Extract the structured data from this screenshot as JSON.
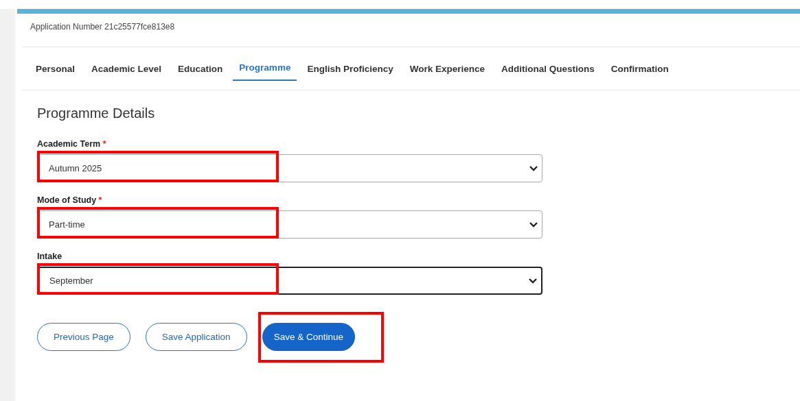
{
  "application_number": "Application Number 21c25577fce813e8",
  "tabs": [
    {
      "label": "Personal",
      "selected": false
    },
    {
      "label": "Academic Level",
      "selected": false
    },
    {
      "label": "Education",
      "selected": false
    },
    {
      "label": "Programme",
      "selected": true
    },
    {
      "label": "English Proficiency",
      "selected": false
    },
    {
      "label": "Work Experience",
      "selected": false
    },
    {
      "label": "Additional Questions",
      "selected": false
    },
    {
      "label": "Confirmation",
      "selected": false
    }
  ],
  "section_title": "Programme Details",
  "fields": [
    {
      "label": "Academic Term",
      "required": true,
      "value": "Autumn 2025",
      "focused": false,
      "highlighted": true
    },
    {
      "label": "Mode of Study",
      "required": true,
      "value": "Part-time",
      "focused": false,
      "highlighted": true
    },
    {
      "label": "Intake",
      "required": false,
      "value": "September",
      "focused": true,
      "highlighted": true
    }
  ],
  "required_mark": "*",
  "buttons": [
    {
      "label": "Previous Page",
      "kind": "outline",
      "highlighted": false
    },
    {
      "label": "Save Application",
      "kind": "outline",
      "highlighted": false
    },
    {
      "label": "Save & Continue",
      "kind": "primary",
      "highlighted": true
    }
  ]
}
